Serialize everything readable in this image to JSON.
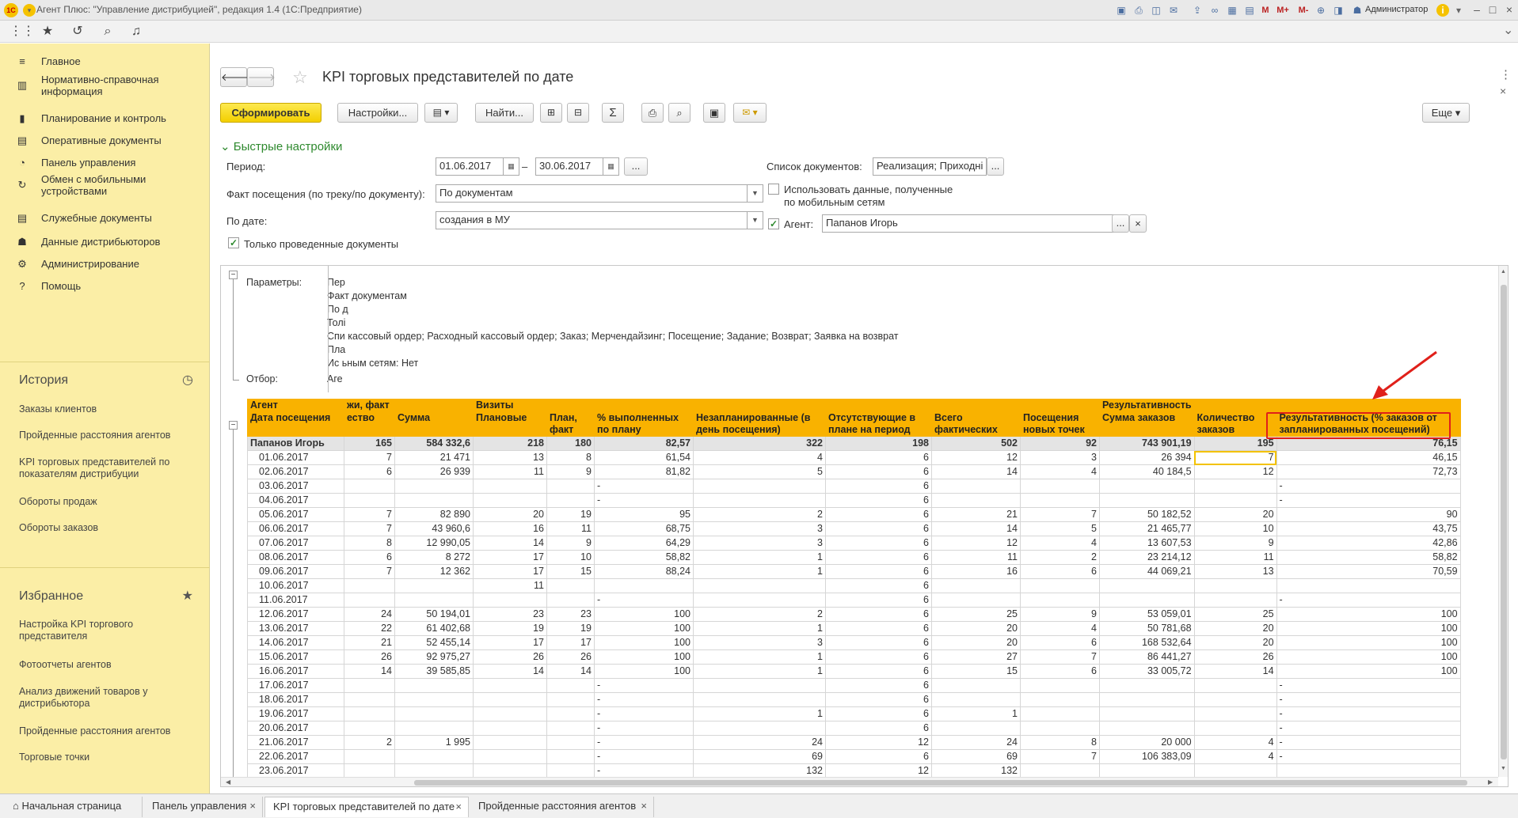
{
  "window": {
    "title": "Агент Плюс: \"Управление дистрибуцией\", редакция 1.4  (1С:Предприятие)",
    "logo": "1С",
    "user": "Администратор",
    "m_labels": [
      "M",
      "M+",
      "M-"
    ]
  },
  "sidebar": {
    "items": [
      {
        "icon": "menu-icon",
        "glyph": "≡",
        "label": "Главное"
      },
      {
        "icon": "book-icon",
        "glyph": "▥",
        "label": "Нормативно-справочная информация"
      },
      {
        "icon": "chart-icon",
        "glyph": "▮",
        "label": "Планирование и контроль"
      },
      {
        "icon": "doc-icon",
        "glyph": "▤",
        "label": "Оперативные документы"
      },
      {
        "icon": "gauge-icon",
        "glyph": "◔",
        "label": "Панель управления"
      },
      {
        "icon": "sync-icon",
        "glyph": "↻",
        "label": "Обмен с мобильными устройствами"
      },
      {
        "icon": "list-icon",
        "glyph": "▤",
        "label": "Служебные документы"
      },
      {
        "icon": "people-icon",
        "glyph": "☗",
        "label": "Данные дистрибьюторов"
      },
      {
        "icon": "gear-icon",
        "glyph": "⚙",
        "label": "Администрирование"
      },
      {
        "icon": "help-icon",
        "glyph": "?",
        "label": "Помощь"
      }
    ],
    "history": {
      "title": "История",
      "items": [
        "Заказы клиентов",
        "Пройденные расстояния агентов",
        "KPI торговых представителей по показателям дистрибуции",
        "Обороты продаж",
        "Обороты заказов"
      ]
    },
    "favorites": {
      "title": "Избранное",
      "items": [
        "Настройка KPI торгового представителя",
        "Фотоотчеты агентов",
        "Анализ движений товаров у дистрибьютора",
        "Пройденные расстояния агентов",
        "Торговые точки"
      ]
    }
  },
  "page": {
    "title": "KPI торговых представителей по дате",
    "buttons": {
      "generate": "Сформировать",
      "settings": "Настройки...",
      "find": "Найти...",
      "more": "Еще"
    },
    "quick": {
      "title": "Быстрые настройки",
      "period_label": "Период:",
      "date_from": "01.06.2017",
      "dash": "–",
      "date_to": "30.06.2017",
      "dots": "...",
      "fact_label": "Факт посещения (по треку/по документу):",
      "fact_value": "По документам",
      "bydate_label": "По дате:",
      "bydate_value": "создания в МУ",
      "posted_only": "Только проведенные документы",
      "doclist_label": "Список документов:",
      "doclist_value": "Реализация; Приходні",
      "mobile_label": "Использовать данные, полученные по мобильным сетям",
      "agent_label": "Агент:",
      "agent_value": "Папанов Игорь",
      "clear": "×"
    }
  },
  "report": {
    "params_label": "Параметры:",
    "params_lines": [
      "Пер",
      "Факт документам",
      "По д",
      "Толі",
      "Спи кассовый ордер; Расходный кассовый ордер; Заказ; Мерчендайзинг; Посещение; Задание; Возврат; Заявка на возврат",
      "Пла",
      "Ис ьным сетям: Нет"
    ],
    "filter_label": "Отбор:",
    "filter_value": "Аге",
    "header1": [
      "Агент",
      "жи, факт",
      "",
      "Визиты",
      "",
      "",
      "",
      "",
      "",
      "",
      "Результативность",
      "",
      ""
    ],
    "header2": [
      "Дата посещения",
      "ество",
      "Сумма",
      "Плановые",
      "План, факт",
      "% выполненных по плану",
      "Незапланированные (в день посещения)",
      "Отсутствующие в плане на период",
      "Всего фактических",
      "Посещения новых точек",
      "Сумма заказов",
      "Количество заказов",
      "Результативность (% заказов от запланированных посещений)"
    ],
    "total": [
      "Папанов Игорь",
      "165",
      "584 332,6",
      "218",
      "180",
      "82,57",
      "322",
      "198",
      "502",
      "92",
      "743 901,19",
      "195",
      "76,15"
    ],
    "rows": [
      [
        "01.06.2017",
        "7",
        "21 471",
        "13",
        "8",
        "61,54",
        "4",
        "6",
        "12",
        "3",
        "26 394",
        "7",
        "46,15"
      ],
      [
        "02.06.2017",
        "6",
        "26 939",
        "11",
        "9",
        "81,82",
        "5",
        "6",
        "14",
        "4",
        "40 184,5",
        "12",
        "72,73"
      ],
      [
        "03.06.2017",
        "",
        "",
        "",
        "",
        "-",
        "",
        "6",
        "",
        "",
        "",
        "",
        "-"
      ],
      [
        "04.06.2017",
        "",
        "",
        "",
        "",
        "-",
        "",
        "6",
        "",
        "",
        "",
        "",
        "-"
      ],
      [
        "05.06.2017",
        "7",
        "82 890",
        "20",
        "19",
        "95",
        "2",
        "6",
        "21",
        "7",
        "50 182,52",
        "20",
        "90"
      ],
      [
        "06.06.2017",
        "7",
        "43 960,6",
        "16",
        "11",
        "68,75",
        "3",
        "6",
        "14",
        "5",
        "21 465,77",
        "10",
        "43,75"
      ],
      [
        "07.06.2017",
        "8",
        "12 990,05",
        "14",
        "9",
        "64,29",
        "3",
        "6",
        "12",
        "4",
        "13 607,53",
        "9",
        "42,86"
      ],
      [
        "08.06.2017",
        "6",
        "8 272",
        "17",
        "10",
        "58,82",
        "1",
        "6",
        "11",
        "2",
        "23 214,12",
        "11",
        "58,82"
      ],
      [
        "09.06.2017",
        "7",
        "12 362",
        "17",
        "15",
        "88,24",
        "1",
        "6",
        "16",
        "6",
        "44 069,21",
        "13",
        "70,59"
      ],
      [
        "10.06.2017",
        "",
        "",
        "11",
        "",
        "",
        "",
        "6",
        "",
        "",
        "",
        "",
        ""
      ],
      [
        "11.06.2017",
        "",
        "",
        "",
        "",
        "-",
        "",
        "6",
        "",
        "",
        "",
        "",
        "-"
      ],
      [
        "12.06.2017",
        "24",
        "50 194,01",
        "23",
        "23",
        "100",
        "2",
        "6",
        "25",
        "9",
        "53 059,01",
        "25",
        "100"
      ],
      [
        "13.06.2017",
        "22",
        "61 402,68",
        "19",
        "19",
        "100",
        "1",
        "6",
        "20",
        "4",
        "50 781,68",
        "20",
        "100"
      ],
      [
        "14.06.2017",
        "21",
        "52 455,14",
        "17",
        "17",
        "100",
        "3",
        "6",
        "20",
        "6",
        "168 532,64",
        "20",
        "100"
      ],
      [
        "15.06.2017",
        "26",
        "92 975,27",
        "26",
        "26",
        "100",
        "1",
        "6",
        "27",
        "7",
        "86 441,27",
        "26",
        "100"
      ],
      [
        "16.06.2017",
        "14",
        "39 585,85",
        "14",
        "14",
        "100",
        "1",
        "6",
        "15",
        "6",
        "33 005,72",
        "14",
        "100"
      ],
      [
        "17.06.2017",
        "",
        "",
        "",
        "",
        "-",
        "",
        "6",
        "",
        "",
        "",
        "",
        "-"
      ],
      [
        "18.06.2017",
        "",
        "",
        "",
        "",
        "-",
        "",
        "6",
        "",
        "",
        "",
        "",
        "-"
      ],
      [
        "19.06.2017",
        "",
        "",
        "",
        "",
        "-",
        "1",
        "6",
        "1",
        "",
        "",
        "",
        "-"
      ],
      [
        "20.06.2017",
        "",
        "",
        "",
        "",
        "-",
        "",
        "6",
        "",
        "",
        "",
        "",
        "-"
      ],
      [
        "21.06.2017",
        "2",
        "1 995",
        "",
        "",
        "-",
        "24",
        "12",
        "24",
        "8",
        "20 000",
        "4",
        "-"
      ],
      [
        "22.06.2017",
        "",
        "",
        "",
        "",
        "-",
        "69",
        "6",
        "69",
        "7",
        "106 383,09",
        "4",
        "-"
      ],
      [
        "23.06.2017",
        "",
        "",
        "",
        "",
        "-",
        "132",
        "12",
        "132",
        "",
        "",
        "",
        ""
      ]
    ]
  },
  "tabs": [
    {
      "label": "Начальная страница",
      "icon": "home-icon"
    },
    {
      "label": "Панель управления",
      "closable": true
    },
    {
      "label": "KPI торговых представителей по дате",
      "closable": true,
      "active": true
    },
    {
      "label": "Пройденные расстояния агентов",
      "closable": true
    }
  ],
  "colors": {
    "sidebar": "#fbeea6",
    "header": "#f9b200",
    "accent": "#f3cf00",
    "highlight": "#e0201a"
  }
}
